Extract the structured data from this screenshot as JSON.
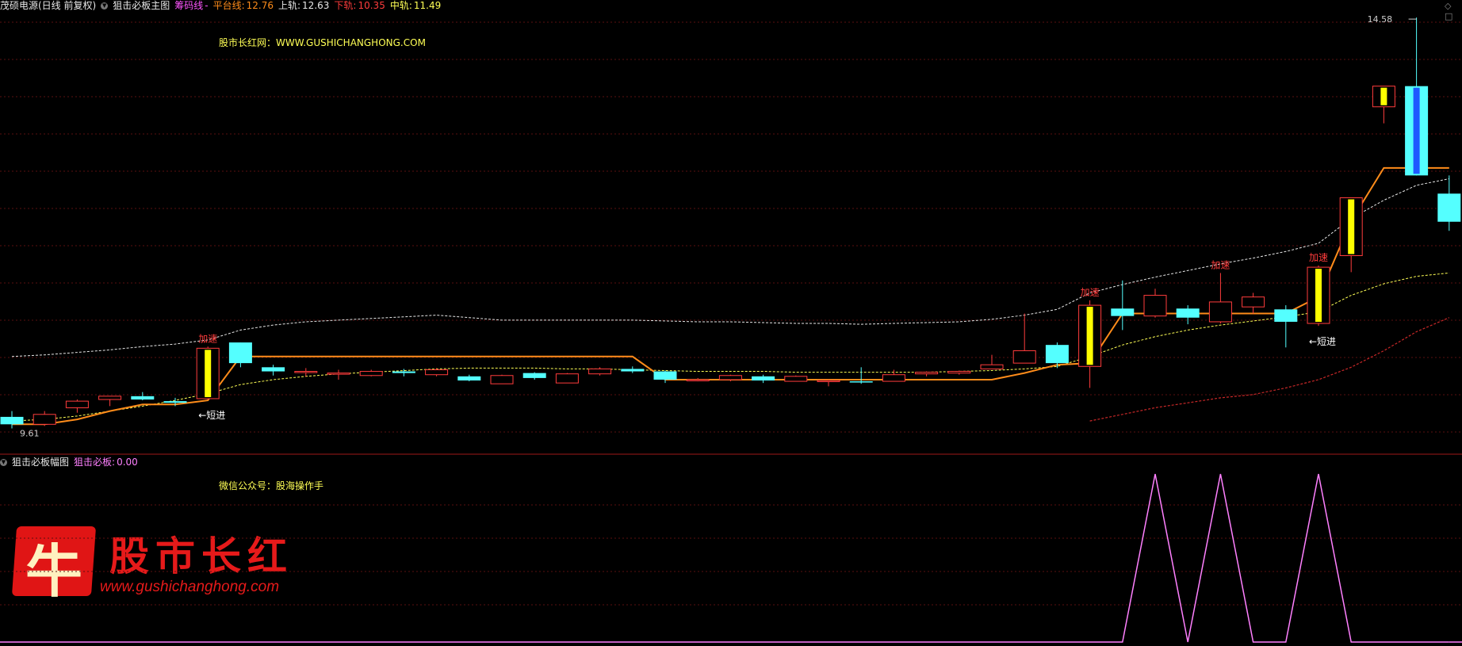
{
  "header": {
    "stock_title": "茂硕电源(日线 前复权)",
    "indicator_title": "狙击必板主图",
    "chip_label": "筹码线",
    "chip_value": "-",
    "platform_label": "平台线",
    "platform_value": "12.76",
    "upper_label": "上轨",
    "upper_value": "12.63",
    "lower_label": "下轨",
    "lower_value": "10.35",
    "middle_label": "中轨",
    "middle_value": "11.49"
  },
  "sub_header": {
    "indicator_title": "狙击必板幅图",
    "signal_label": "狙击必板",
    "signal_value": "0.00"
  },
  "watermark_main": "股市长红网：WWW.GUSHICHANGHONG.COM",
  "watermark_sub": "微信公众号：股海操作手",
  "logo": {
    "char": "牛",
    "title": "股市长红",
    "url": "www.gushichanghong.com"
  },
  "annotations": {
    "short_entry": "←短进",
    "accelerate": "加速",
    "high_price": "14.58",
    "low_price": "9.61"
  },
  "colors": {
    "up": "#ff3c3c",
    "down": "#54ffff",
    "platform": "#ff8c1a",
    "upper_band": "#e6e6e6",
    "middle_band": "#ffff55",
    "lower_band": "#c82828",
    "signal": "#ff80ff",
    "limit_up": "#ffff00",
    "limit_up_strong": "#1e5aff"
  },
  "chart_data": {
    "type": "candlestick",
    "price_range": [
      9.5,
      14.6
    ],
    "candles": [
      {
        "o": 9.75,
        "h": 9.82,
        "l": 9.61,
        "c": 9.66,
        "mark": ""
      },
      {
        "o": 9.66,
        "h": 9.82,
        "l": 9.64,
        "c": 9.78,
        "mark": ""
      },
      {
        "o": 9.86,
        "h": 9.96,
        "l": 9.8,
        "c": 9.94,
        "mark": ""
      },
      {
        "o": 9.96,
        "h": 10.0,
        "l": 9.88,
        "c": 10.0,
        "mark": ""
      },
      {
        "o": 10.0,
        "h": 10.05,
        "l": 9.95,
        "c": 9.96,
        "mark": ""
      },
      {
        "o": 9.94,
        "h": 9.98,
        "l": 9.88,
        "c": 9.92,
        "mark": ""
      },
      {
        "o": 9.97,
        "h": 10.6,
        "l": 9.96,
        "c": 10.58,
        "mark": "limit"
      },
      {
        "o": 10.65,
        "h": 10.65,
        "l": 10.35,
        "c": 10.4,
        "mark": ""
      },
      {
        "o": 10.35,
        "h": 10.38,
        "l": 10.25,
        "c": 10.3,
        "mark": ""
      },
      {
        "o": 10.3,
        "h": 10.34,
        "l": 10.24,
        "c": 10.3,
        "mark": ""
      },
      {
        "o": 10.28,
        "h": 10.32,
        "l": 10.2,
        "c": 10.28,
        "mark": ""
      },
      {
        "o": 10.25,
        "h": 10.32,
        "l": 10.24,
        "c": 10.3,
        "mark": ""
      },
      {
        "o": 10.3,
        "h": 10.33,
        "l": 10.24,
        "c": 10.28,
        "mark": ""
      },
      {
        "o": 10.26,
        "h": 10.34,
        "l": 10.24,
        "c": 10.32,
        "mark": ""
      },
      {
        "o": 10.24,
        "h": 10.26,
        "l": 10.18,
        "c": 10.19,
        "mark": ""
      },
      {
        "o": 10.15,
        "h": 10.26,
        "l": 10.15,
        "c": 10.25,
        "mark": ""
      },
      {
        "o": 10.28,
        "h": 10.29,
        "l": 10.2,
        "c": 10.22,
        "mark": ""
      },
      {
        "o": 10.16,
        "h": 10.28,
        "l": 10.16,
        "c": 10.27,
        "mark": ""
      },
      {
        "o": 10.27,
        "h": 10.35,
        "l": 10.25,
        "c": 10.33,
        "mark": ""
      },
      {
        "o": 10.33,
        "h": 10.36,
        "l": 10.28,
        "c": 10.3,
        "mark": ""
      },
      {
        "o": 10.3,
        "h": 10.31,
        "l": 10.16,
        "c": 10.2,
        "mark": ""
      },
      {
        "o": 10.2,
        "h": 10.22,
        "l": 10.18,
        "c": 10.2,
        "mark": ""
      },
      {
        "o": 10.2,
        "h": 10.26,
        "l": 10.18,
        "c": 10.25,
        "mark": ""
      },
      {
        "o": 10.24,
        "h": 10.26,
        "l": 10.16,
        "c": 10.19,
        "mark": ""
      },
      {
        "o": 10.18,
        "h": 10.25,
        "l": 10.18,
        "c": 10.24,
        "mark": ""
      },
      {
        "o": 10.18,
        "h": 10.2,
        "l": 10.12,
        "c": 10.19,
        "mark": ""
      },
      {
        "o": 10.18,
        "h": 10.35,
        "l": 10.15,
        "c": 10.17,
        "mark": ""
      },
      {
        "o": 10.18,
        "h": 10.32,
        "l": 10.18,
        "c": 10.26,
        "mark": ""
      },
      {
        "o": 10.27,
        "h": 10.3,
        "l": 10.24,
        "c": 10.29,
        "mark": ""
      },
      {
        "o": 10.28,
        "h": 10.31,
        "l": 10.26,
        "c": 10.3,
        "mark": ""
      },
      {
        "o": 10.33,
        "h": 10.5,
        "l": 10.33,
        "c": 10.38,
        "mark": ""
      },
      {
        "o": 10.4,
        "h": 11.0,
        "l": 10.4,
        "c": 10.55,
        "mark": ""
      },
      {
        "o": 10.62,
        "h": 10.65,
        "l": 10.34,
        "c": 10.4,
        "mark": ""
      },
      {
        "o": 10.36,
        "h": 11.16,
        "l": 10.1,
        "c": 11.1,
        "mark": "limit"
      },
      {
        "o": 11.06,
        "h": 11.4,
        "l": 10.8,
        "c": 10.97,
        "mark": ""
      },
      {
        "o": 10.97,
        "h": 11.3,
        "l": 10.95,
        "c": 11.22,
        "mark": ""
      },
      {
        "o": 11.06,
        "h": 11.1,
        "l": 10.87,
        "c": 10.95,
        "mark": ""
      },
      {
        "o": 10.9,
        "h": 11.49,
        "l": 10.88,
        "c": 11.14,
        "mark": ""
      },
      {
        "o": 11.08,
        "h": 11.25,
        "l": 11.0,
        "c": 11.2,
        "mark": ""
      },
      {
        "o": 11.05,
        "h": 11.1,
        "l": 10.59,
        "c": 10.9,
        "mark": ""
      },
      {
        "o": 10.88,
        "h": 11.58,
        "l": 10.85,
        "c": 11.56,
        "mark": "limit"
      },
      {
        "o": 11.7,
        "h": 12.4,
        "l": 11.5,
        "c": 12.4,
        "mark": "limit"
      },
      {
        "o": 13.5,
        "h": 13.75,
        "l": 13.3,
        "c": 13.75,
        "mark": "limit"
      },
      {
        "o": 13.75,
        "h": 14.58,
        "l": 12.67,
        "c": 12.67,
        "mark": "limit_strong"
      },
      {
        "o": 12.45,
        "h": 12.67,
        "l": 12.0,
        "c": 12.11,
        "mark": ""
      }
    ],
    "platform_line": [
      9.66,
      9.66,
      9.72,
      9.82,
      9.9,
      9.9,
      9.95,
      10.48,
      10.48,
      10.48,
      10.48,
      10.48,
      10.48,
      10.48,
      10.48,
      10.48,
      10.48,
      10.48,
      10.48,
      10.48,
      10.2,
      10.2,
      10.2,
      10.2,
      10.2,
      10.2,
      10.2,
      10.2,
      10.2,
      10.2,
      10.2,
      10.28,
      10.38,
      10.4,
      11.0,
      11.0,
      11.0,
      11.0,
      11.0,
      11.0,
      11.2,
      12.12,
      12.76,
      12.76,
      12.76
    ],
    "upper_band": [
      10.48,
      10.5,
      10.53,
      10.56,
      10.6,
      10.63,
      10.68,
      10.8,
      10.86,
      10.9,
      10.92,
      10.94,
      10.96,
      10.98,
      10.95,
      10.92,
      10.92,
      10.92,
      10.92,
      10.92,
      10.91,
      10.9,
      10.9,
      10.89,
      10.88,
      10.88,
      10.87,
      10.88,
      10.89,
      10.9,
      10.93,
      10.98,
      11.05,
      11.25,
      11.35,
      11.44,
      11.52,
      11.6,
      11.67,
      11.75,
      11.85,
      12.15,
      12.37,
      12.55,
      12.63
    ],
    "middle_band": [
      9.7,
      9.72,
      9.76,
      9.82,
      9.88,
      9.95,
      10.03,
      10.14,
      10.2,
      10.24,
      10.27,
      10.29,
      10.31,
      10.33,
      10.34,
      10.34,
      10.34,
      10.33,
      10.33,
      10.32,
      10.31,
      10.3,
      10.3,
      10.3,
      10.29,
      10.29,
      10.29,
      10.29,
      10.29,
      10.3,
      10.31,
      10.33,
      10.36,
      10.48,
      10.62,
      10.72,
      10.8,
      10.86,
      10.91,
      10.96,
      11.02,
      11.22,
      11.36,
      11.45,
      11.49
    ],
    "lower_band": [
      null,
      null,
      null,
      null,
      null,
      null,
      null,
      null,
      null,
      null,
      null,
      null,
      null,
      null,
      null,
      null,
      null,
      null,
      null,
      null,
      null,
      null,
      null,
      null,
      null,
      null,
      null,
      null,
      null,
      null,
      null,
      null,
      null,
      9.7,
      9.78,
      9.86,
      9.92,
      9.98,
      10.02,
      10.1,
      10.2,
      10.35,
      10.55,
      10.78,
      10.95
    ],
    "accelerate_at": [
      6,
      33,
      37,
      40
    ],
    "short_entry_at": [
      6,
      40
    ],
    "signal_series": [
      0,
      0,
      0,
      0,
      0,
      0,
      0,
      0,
      0,
      0,
      0,
      0,
      0,
      0,
      0,
      0,
      0,
      0,
      0,
      0,
      0,
      0,
      0,
      0,
      0,
      0,
      0,
      0,
      0,
      0,
      0,
      0,
      0,
      0,
      0,
      1,
      0,
      1,
      0,
      0,
      1,
      0,
      0,
      0,
      0
    ],
    "signal_range": [
      0,
      1
    ]
  }
}
